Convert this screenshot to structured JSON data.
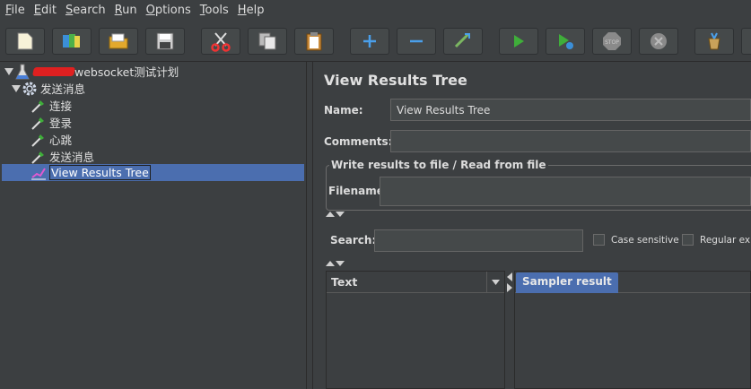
{
  "menu": [
    {
      "mnemonic": "F",
      "rest": "ile"
    },
    {
      "mnemonic": "E",
      "rest": "dit"
    },
    {
      "mnemonic": "S",
      "rest": "earch"
    },
    {
      "mnemonic": "R",
      "rest": "un"
    },
    {
      "mnemonic": "O",
      "rest": "ptions"
    },
    {
      "mnemonic": "T",
      "rest": "ools"
    },
    {
      "mnemonic": "H",
      "rest": "elp"
    }
  ],
  "toolbar": {
    "buttons": [
      "new-icon",
      "templates-icon",
      "open-icon",
      "save-icon",
      "cut-icon",
      "copy-icon",
      "paste-icon",
      "expand-icon",
      "collapse-icon",
      "toggle-icon",
      "start-icon",
      "start-no-pauses-icon",
      "stop-icon",
      "shutdown-icon",
      "clear-icon"
    ],
    "stop_text": "STOP"
  },
  "tree": {
    "root_label": "websocket测试计划",
    "thread_group": "发送消息",
    "samplers": [
      "连接",
      "登录",
      "心跳",
      "发送消息"
    ],
    "listener": "View Results Tree"
  },
  "panel": {
    "title": "View Results Tree",
    "name_label": "Name:",
    "name_value": "View Results Tree",
    "comments_label": "Comments:",
    "comments_value": "",
    "group_title": "Write results to file / Read from file",
    "filename_label": "Filename",
    "filename_value": "",
    "search_label": "Search:",
    "search_value": "",
    "case_sensitive": "Case sensitive",
    "regular_exp": "Regular exp",
    "results_header": "Text",
    "tab_sampler": "Sampler result"
  },
  "colors": {
    "background": "#3c3f41",
    "selection": "#4b6eaf",
    "field": "#45494a"
  }
}
